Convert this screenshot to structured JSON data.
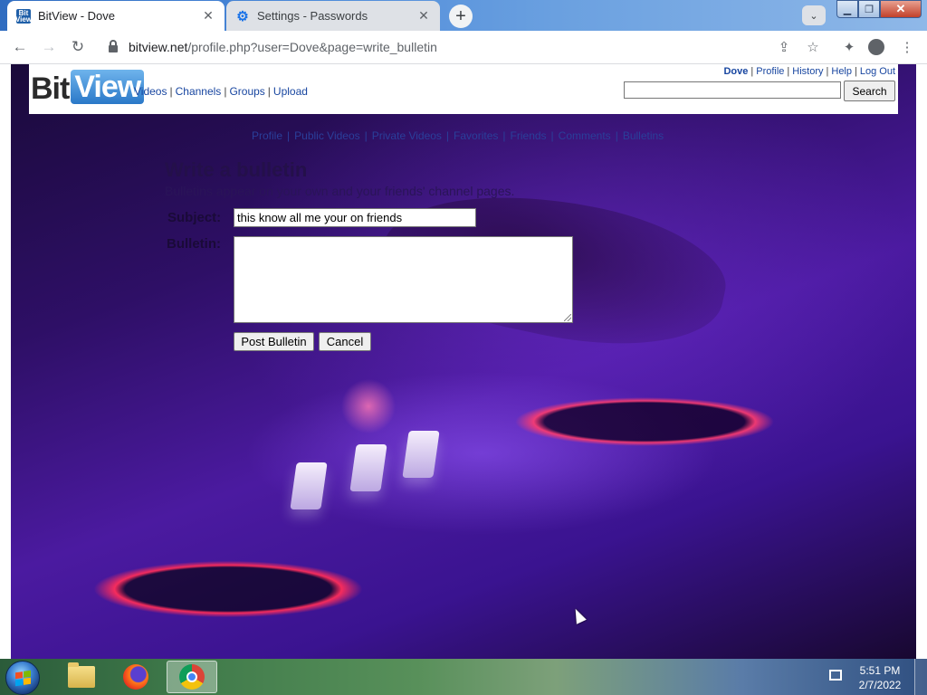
{
  "browser": {
    "tabs": [
      {
        "title": "BitView - Dove",
        "favicon": "bitview-favicon"
      },
      {
        "title": "Settings - Passwords",
        "favicon": "gear-icon"
      }
    ],
    "url_host": "bitview.net",
    "url_path": "/profile.php?user=Dove&page=write_bulletin"
  },
  "site": {
    "logo_bit": "Bit",
    "logo_view": "View",
    "main_nav": [
      "Videos",
      "Channels",
      "Groups",
      "Upload"
    ],
    "user_nav": [
      "Dove",
      "Profile",
      "History",
      "Help",
      "Log Out"
    ],
    "search_button": "Search",
    "search_value": ""
  },
  "profile_nav": [
    "Profile",
    "Public Videos",
    "Private Videos",
    "Favorites",
    "Friends",
    "Comments",
    "Bulletins"
  ],
  "form": {
    "title": "Write a bulletin",
    "description": "Bulletins appear on your own and your friends' channel pages.",
    "subject_label": "Subject:",
    "subject_value": "this know all me your on friends",
    "bulletin_label": "Bulletin:",
    "bulletin_value": "",
    "post_button": "Post Bulletin",
    "cancel_button": "Cancel"
  },
  "taskbar": {
    "time": "5:51 PM",
    "date": "2/7/2022",
    "apps": [
      "file-explorer-icon",
      "firefox-icon",
      "chrome-icon"
    ]
  },
  "colors": {
    "link": "#1846a0",
    "profile_nav_link": "#2a3f9a",
    "page_background": "#3a1390"
  }
}
